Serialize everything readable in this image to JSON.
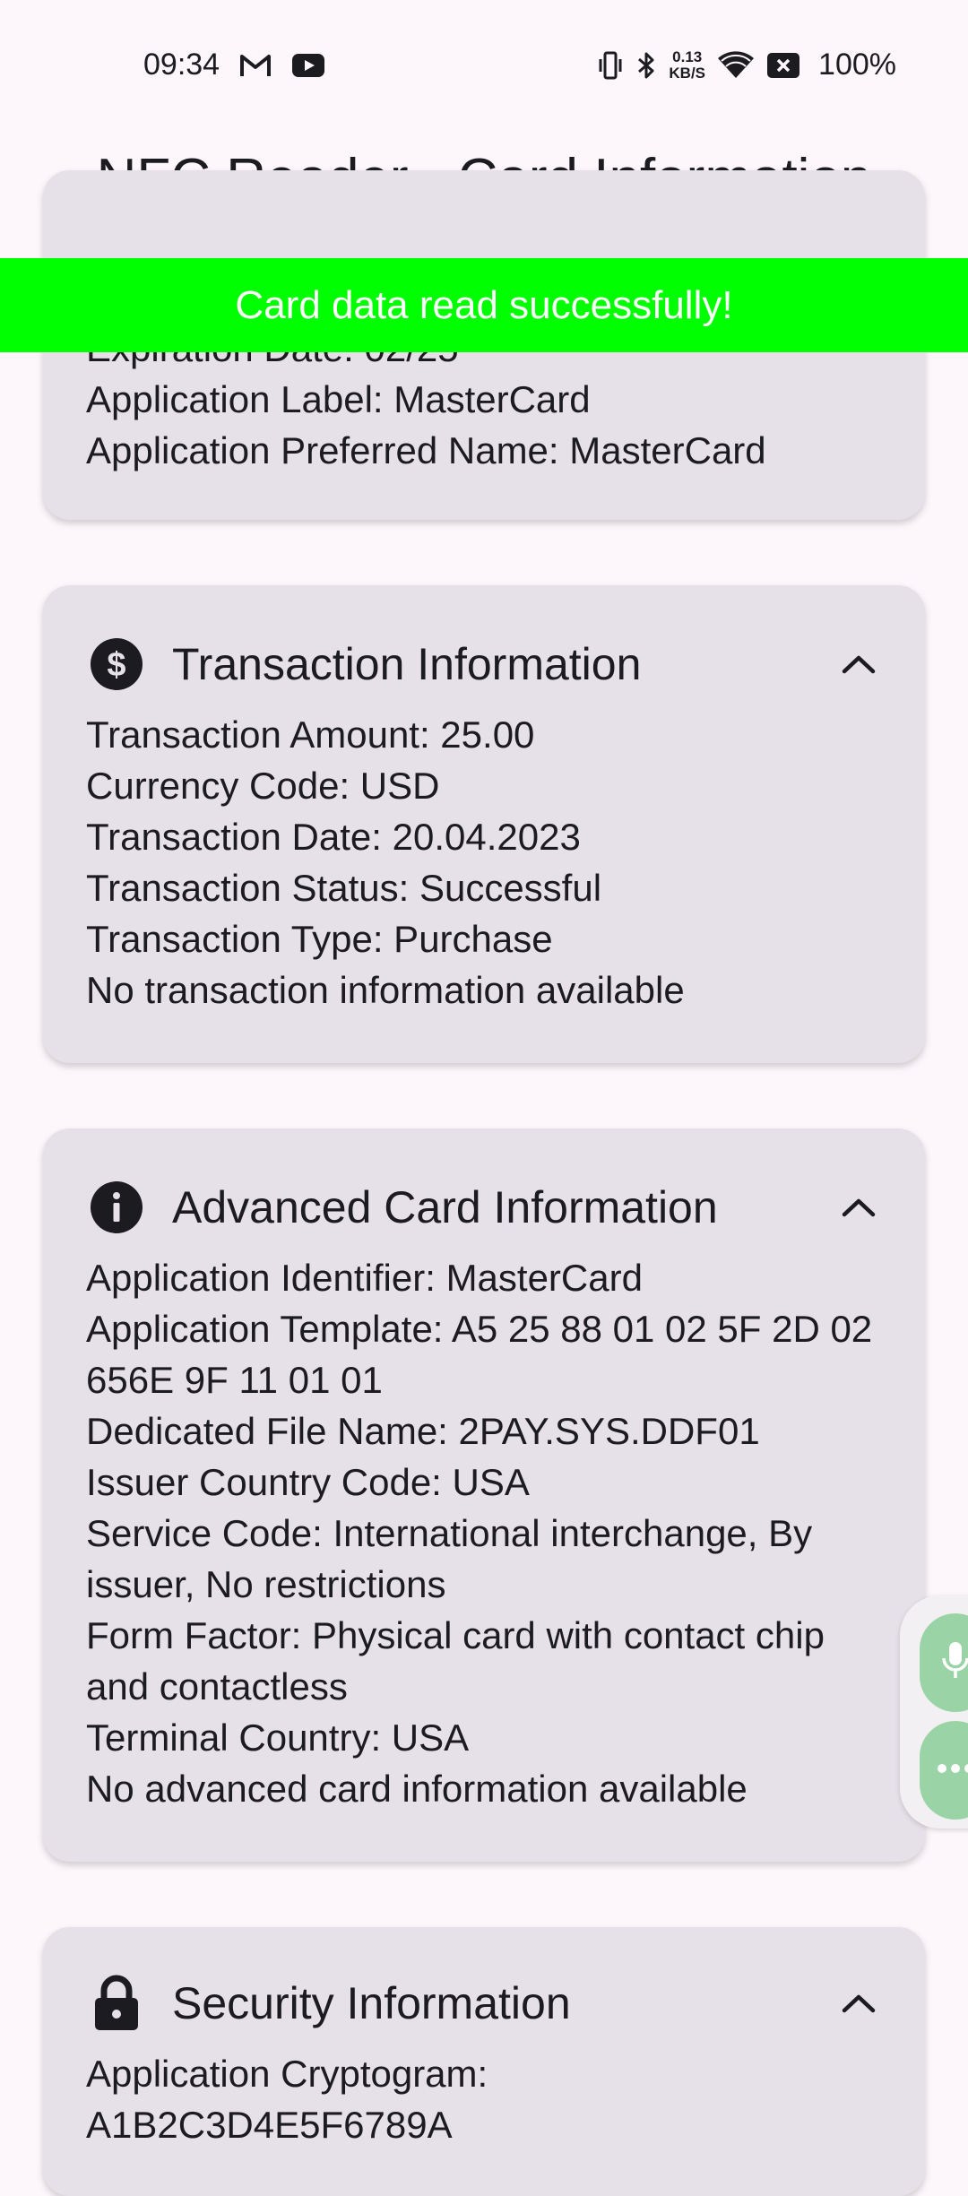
{
  "status_bar": {
    "time": "09:34",
    "left_icons": [
      "gmail-icon",
      "youtube-icon"
    ],
    "right_icons": [
      "vibrate-icon",
      "bluetooth-icon",
      "wifi-icon",
      "battery-x-icon"
    ],
    "net_speed_value": "0.13",
    "net_speed_unit": "KB/S",
    "battery": "100%"
  },
  "header": {
    "title": "NFC Reader - Card Information"
  },
  "toast": {
    "message": "Card data read successfully!"
  },
  "cards": {
    "card_info": {
      "lines": [
        "Expiration Date: 02/25",
        "Application Label: MasterCard",
        "Application Preferred Name: MasterCard"
      ]
    },
    "transaction": {
      "title": "Transaction Information",
      "icon": "dollar-icon",
      "lines": [
        "Transaction Amount: 25.00",
        "Currency Code: USD",
        "Transaction Date: 20.04.2023",
        "Transaction Status: Successful",
        "Transaction Type: Purchase",
        "No transaction information available"
      ]
    },
    "advanced": {
      "title": "Advanced Card Information",
      "icon": "info-icon",
      "lines": [
        "Application Identifier: MasterCard",
        "Application Template: A5 25 88 01 02 5F 2D 02 656E 9F 11 01 01",
        "Dedicated File Name: 2PAY.SYS.DDF01",
        "Issuer Country Code: USA",
        "Service Code: International interchange, By issuer, No restrictions",
        "Form Factor: Physical card with contact chip and contactless",
        "Terminal Country: USA",
        "No advanced card information available"
      ]
    },
    "security": {
      "title": "Security Information",
      "icon": "lock-icon",
      "lines": [
        "Application Cryptogram: A1B2C3D4E5F6789A"
      ]
    }
  },
  "floating_buttons": [
    "microphone-icon",
    "more-icon"
  ],
  "colors": {
    "background": "#fdf7fc",
    "card": "#e6e0e9",
    "toast": "#00ff00",
    "toast_text": "#ffffff",
    "fab": "#9ad3a6"
  }
}
